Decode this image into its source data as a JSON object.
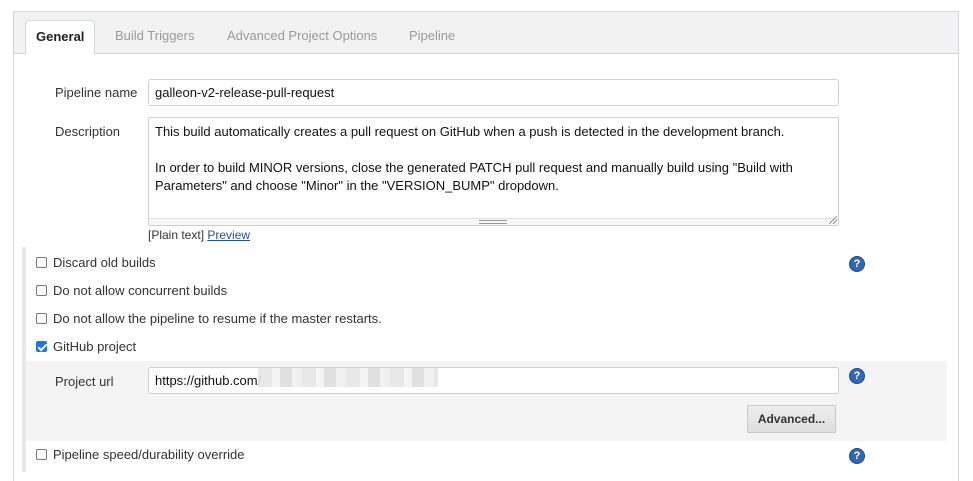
{
  "tabs": [
    {
      "label": "General",
      "active": true
    },
    {
      "label": "Build Triggers",
      "active": false
    },
    {
      "label": "Advanced Project Options",
      "active": false
    },
    {
      "label": "Pipeline",
      "active": false
    }
  ],
  "form": {
    "pipeline_name_label": "Pipeline name",
    "pipeline_name_value": "galleon-v2-release-pull-request",
    "description_label": "Description",
    "description_paragraph1": "This build automatically creates a pull request on GitHub when a push is detected in the development branch.",
    "description_paragraph2": "In order to build MINOR versions, close the generated PATCH pull request and manually build using \"Build with Parameters\" and choose \"Minor\" in the \"VERSION_BUMP\" dropdown.",
    "plain_text": "[Plain text]",
    "preview_link": "Preview"
  },
  "options": {
    "discard_old_builds": {
      "label": "Discard old builds",
      "checked": false
    },
    "no_concurrent_builds": {
      "label": "Do not allow concurrent builds",
      "checked": false
    },
    "no_resume": {
      "label": "Do not allow the pipeline to resume if the master restarts.",
      "checked": false
    },
    "github_project": {
      "label": "GitHub project",
      "checked": true
    },
    "durability_override": {
      "label": "Pipeline speed/durability override",
      "checked": false
    }
  },
  "github": {
    "project_url_label": "Project url",
    "project_url_value": "https://github.com/",
    "advanced_button": "Advanced..."
  },
  "icons": {
    "help": "help-icon",
    "help_glyph": "?"
  },
  "colors": {
    "accent": "#1e74e5",
    "help": "#2f69b5",
    "link": "#2a4f9e"
  }
}
